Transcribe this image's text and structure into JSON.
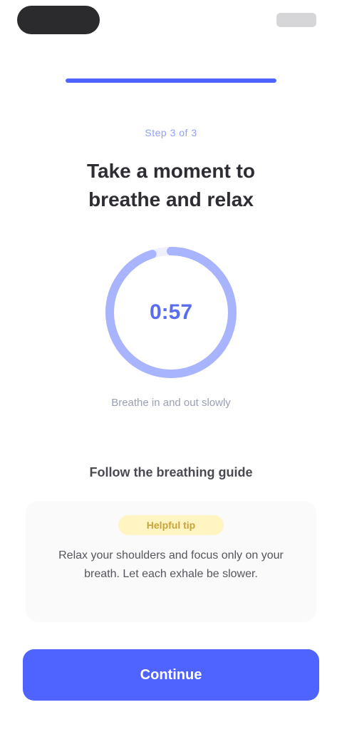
{
  "progress": {
    "value": 1.0
  },
  "header": {
    "eyebrow": "Step 3 of 3",
    "title": "Take a moment to breathe and relax"
  },
  "timer": {
    "value": "0:57",
    "caption": "Breathe in and out slowly",
    "ring_fraction": 0.95
  },
  "tips": {
    "section_title": "Follow the breathing guide",
    "badge": "Helpful tip",
    "text": "Relax your shoulders and focus only on your breath. Let each exhale be slower."
  },
  "cta": {
    "label": "Continue"
  },
  "colors": {
    "accent": "#4f63ff",
    "ring": "#a9b4ff",
    "badge_bg": "#fff4c2"
  }
}
